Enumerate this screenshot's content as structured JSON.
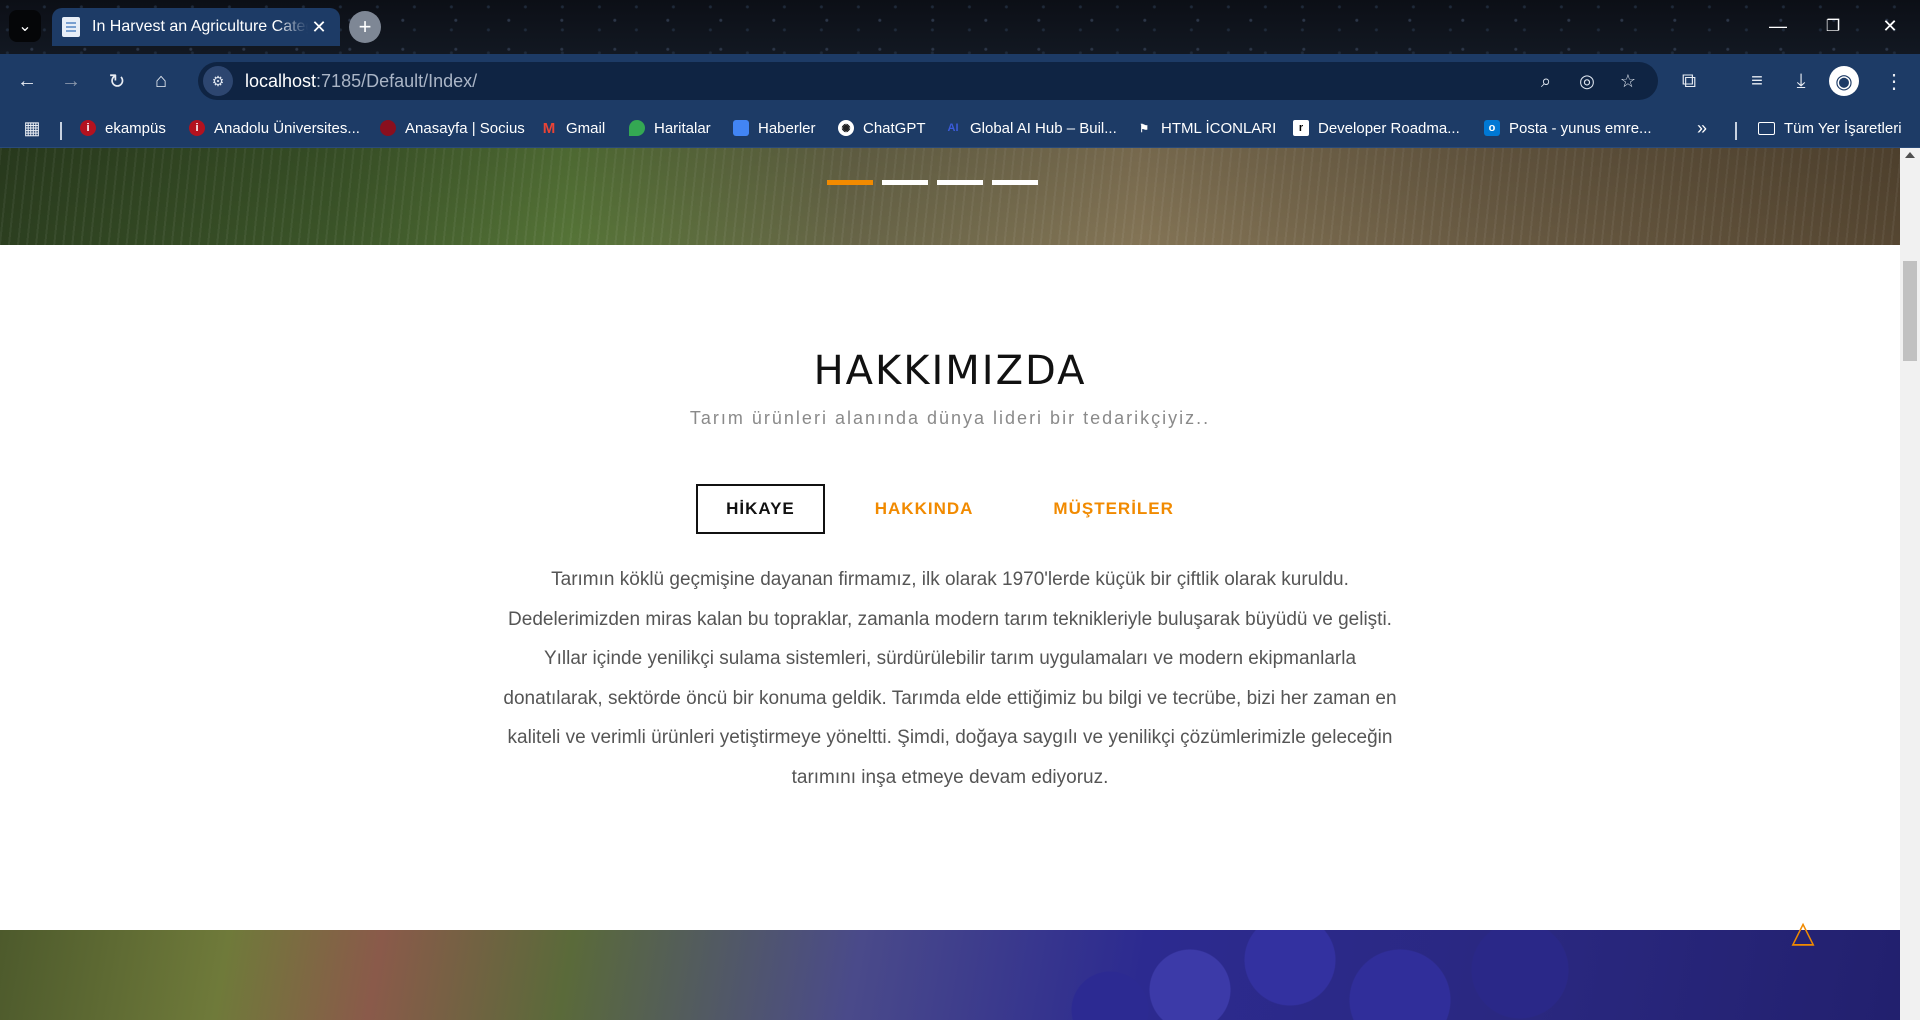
{
  "browser": {
    "tab_title": "In Harvest an Agriculture Category",
    "url_host": "localhost",
    "url_path": ":7185/Default/Index/",
    "bookmarks": [
      {
        "label": "ekampüs",
        "color": "#b3121f"
      },
      {
        "label": "Anadolu Üniversites...",
        "color": "#b3121f"
      },
      {
        "label": "Anasayfa | Socius",
        "color": "#8a0f1e"
      },
      {
        "label": "Gmail",
        "color": "#ea4335"
      },
      {
        "label": "Haritalar",
        "color": "#34a853"
      },
      {
        "label": "Haberler",
        "color": "#4285f4"
      },
      {
        "label": "ChatGPT",
        "color": "#202123"
      },
      {
        "label": "Global AI Hub – Buil...",
        "color": "#3b5bdb"
      },
      {
        "label": "HTML İCONLARI",
        "color": "#000000"
      },
      {
        "label": "Developer Roadma...",
        "color": "#000000"
      },
      {
        "label": "Posta - yunus emre...",
        "color": "#0078d4"
      }
    ],
    "all_bookmarks_label": "Tüm Yer İşaretleri",
    "overflow_label": "»"
  },
  "hero": {
    "slides": 4,
    "active_slide": 1,
    "accent_color": "#f18a00"
  },
  "about": {
    "title": "HAKKIMIZDA",
    "subtitle": "Tarım ürünleri alanında dünya lideri bir tedarikçiyiz..",
    "tabs": [
      {
        "label": "HİKAYE",
        "active": true
      },
      {
        "label": "HAKKINDA",
        "active": false
      },
      {
        "label": "MÜŞTERİLER",
        "active": false
      }
    ],
    "text": "Tarımın köklü geçmişine dayanan firmamız, ilk olarak 1970'lerde küçük bir çiftlik olarak kuruldu. Dedelerimizden miras kalan bu topraklar, zamanla modern tarım teknikleriyle buluşarak büyüdü ve gelişti. Yıllar içinde yenilikçi sulama sistemleri, sürdürülebilir tarım uygulamaları ve modern ekipmanlarla donatılarak, sektörde öncü bir konuma geldik. Tarımda elde ettiğimiz bu bilgi ve tecrübe, bizi her zaman en kaliteli ve verimli ürünleri yetiştirmeye yöneltti. Şimdi, doğaya saygılı ve yenilikçi çözümlerimizle geleceğin tarımını inşa etmeye devam ediyoruz."
  },
  "icons": {
    "scroll_top": "triangle-up-icon"
  }
}
